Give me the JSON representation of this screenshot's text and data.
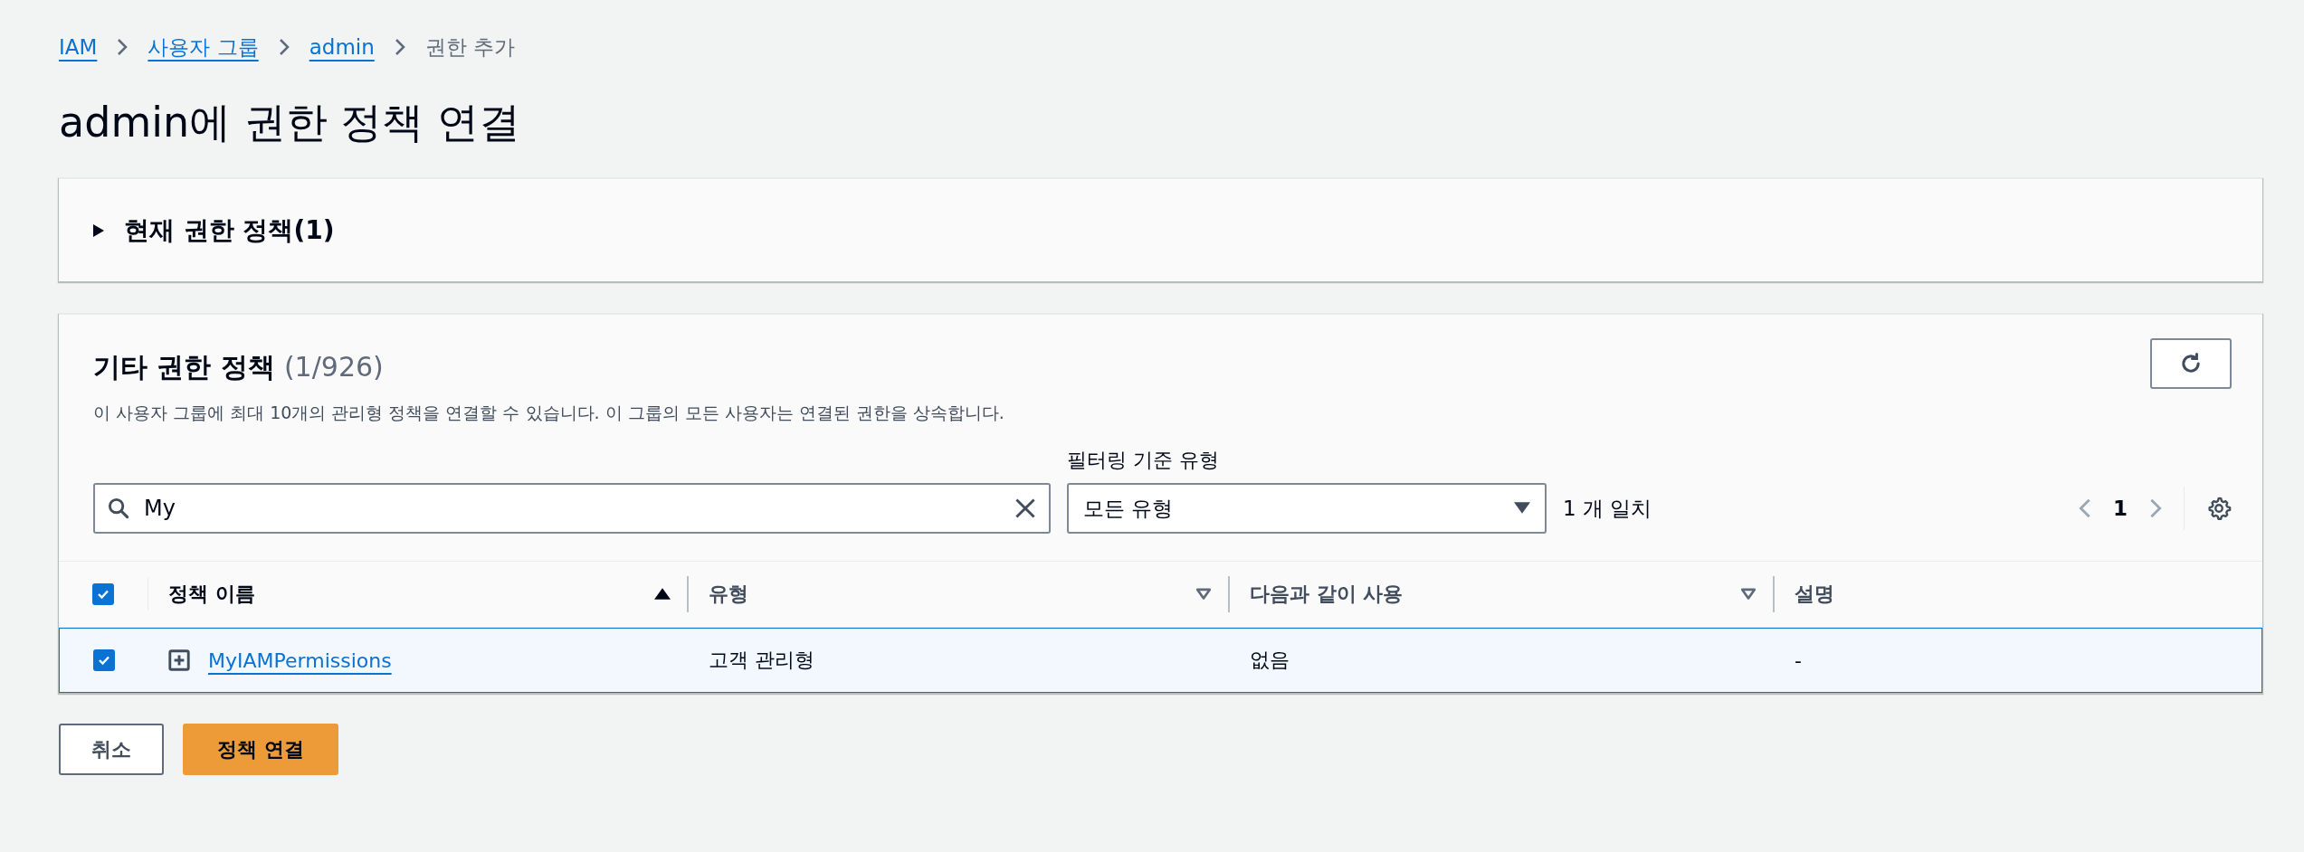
{
  "breadcrumbs": [
    {
      "label": "IAM",
      "link": true
    },
    {
      "label": "사용자 그룹",
      "link": true
    },
    {
      "label": "admin",
      "link": true
    },
    {
      "label": "권한 추가",
      "link": false
    }
  ],
  "title": "admin에 권한 정책 연결",
  "current_policies": {
    "label": "현재 권한 정책(1)",
    "expanded": false
  },
  "other_policies": {
    "title": "기타 권한 정책",
    "count": "(1/926)",
    "description": "이 사용자 그룹에 최대 10개의 관리형 정책을 연결할 수 있습니다. 이 그룹의 모든 사용자는 연결된 권한을 상속합니다.",
    "search": {
      "value": "My"
    },
    "filter": {
      "label": "필터링 기준 유형",
      "value": "모든 유형"
    },
    "match_count": "1 개 일치",
    "pagination": {
      "page": "1"
    },
    "table": {
      "all_checked": true,
      "columns": [
        {
          "label": "정책 이름",
          "sorted": true
        },
        {
          "label": "유형",
          "sorted": false
        },
        {
          "label": "다음과 같이 사용",
          "sorted": false
        },
        {
          "label": "설명"
        }
      ],
      "rows": [
        {
          "selected": true,
          "name": "MyIAMPermissions",
          "type": "고객 관리형",
          "used_as": "없음",
          "description": "-"
        }
      ]
    }
  },
  "buttons": [
    {
      "label": "취소",
      "kind": "secondary"
    },
    {
      "label": "정책 연결",
      "kind": "primary"
    }
  ]
}
